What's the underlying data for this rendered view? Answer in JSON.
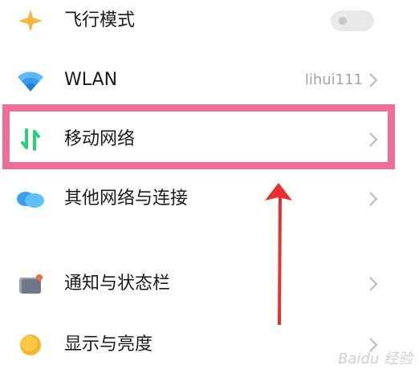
{
  "settings": {
    "items": [
      {
        "label": "飞行模式",
        "icon": "airplane-icon",
        "control": "toggle",
        "toggle_on": false
      },
      {
        "label": "WLAN",
        "icon": "wifi-icon",
        "value": "lihui111",
        "control": "chevron"
      },
      {
        "label": "移动网络",
        "icon": "mobile-data-icon",
        "control": "chevron",
        "highlighted": true
      },
      {
        "label": "其他网络与连接",
        "icon": "other-network-icon",
        "control": "chevron"
      },
      {
        "label": "通知与状态栏",
        "icon": "notification-icon",
        "control": "chevron"
      },
      {
        "label": "显示与亮度",
        "icon": "display-brightness-icon",
        "control": "chevron"
      }
    ]
  },
  "annotation": {
    "box_color": "#ee6e98",
    "arrow_color": "#e8312f"
  },
  "watermark": {
    "text": "Baidu 经验"
  }
}
